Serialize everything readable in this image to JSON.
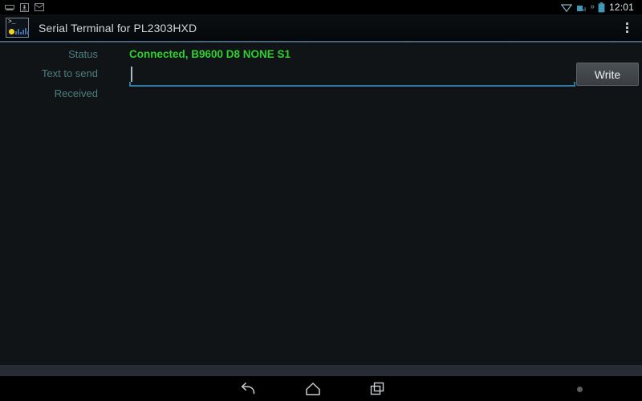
{
  "status_bar": {
    "left_icons": [
      {
        "name": "usb-debug-icon",
        "glyph": "usb"
      },
      {
        "name": "download-icon",
        "glyph": "download"
      },
      {
        "name": "email-icon",
        "glyph": "email"
      }
    ],
    "right_icons": [
      {
        "name": "wifi-icon",
        "glyph": "wifi"
      },
      {
        "name": "cellular-signal-icon",
        "glyph": "signal"
      }
    ],
    "more_notifications": "»",
    "battery": {
      "name": "battery-icon",
      "level_hint": "full"
    },
    "clock": "12:01"
  },
  "action_bar": {
    "app_icon_name": "serial-terminal-app-icon",
    "app_icon_prompt": ">_",
    "title": "Serial Terminal for PL2303HXD",
    "overflow_menu_label": "More options"
  },
  "form": {
    "status": {
      "label": "Status",
      "value": "Connected, B9600 D8 NONE S1",
      "value_color": "#2fd02f"
    },
    "text_to_send": {
      "label": "Text to send",
      "value": "",
      "placeholder": "",
      "focused": true,
      "underline_color": "#2e7ba6"
    },
    "received": {
      "label": "Received",
      "value": ""
    },
    "write_button": {
      "label": "Write"
    },
    "label_color": "#4d7e7f"
  },
  "nav_bar": {
    "buttons": [
      {
        "name": "nav-back-button",
        "label": "Back"
      },
      {
        "name": "nav-home-button",
        "label": "Home"
      },
      {
        "name": "nav-recents-button",
        "label": "Recent apps"
      }
    ],
    "menu_dot_label": "Menu"
  },
  "theme": {
    "background": "#101417",
    "status_bar_bg": "#000000",
    "action_bar_bg": "#0b0f12",
    "divider": "#5c7d96",
    "nav_bar_bg": "#000000",
    "bottom_band": "#272b33"
  }
}
